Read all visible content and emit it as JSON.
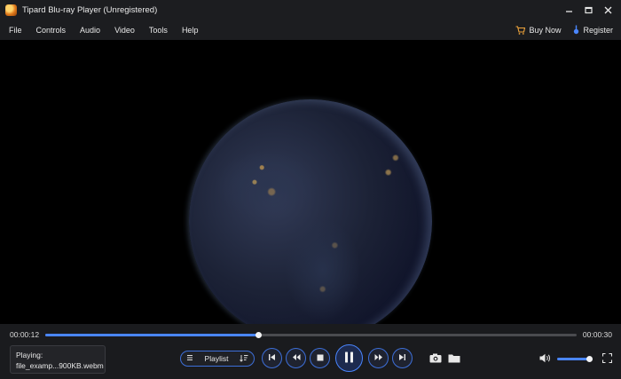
{
  "window": {
    "title": "Tipard Blu-ray Player (Unregistered)",
    "controls": [
      "minimize-icon",
      "maximize-icon",
      "close-icon"
    ]
  },
  "menu": {
    "items": [
      "File",
      "Controls",
      "Audio",
      "Video",
      "Tools",
      "Help"
    ],
    "buy_now": "Buy Now",
    "register": "Register"
  },
  "player": {
    "current_time": "00:00:12",
    "total_time": "00:00:30",
    "progress_fraction": 0.4,
    "volume_fraction": 0.9,
    "accent_color": "#4a86ff"
  },
  "now_playing": {
    "label": "Playing:",
    "file": "file_examp...900KB.webm"
  },
  "playlist": {
    "label": "Playlist"
  }
}
